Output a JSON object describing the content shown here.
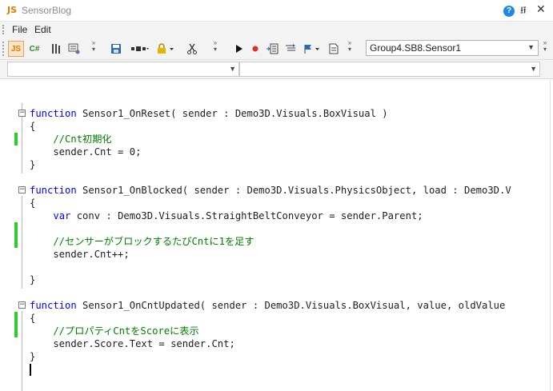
{
  "window": {
    "badge": "JS",
    "title": "SensorBlog",
    "help_glyph": "?",
    "pin_glyph": "⭿",
    "close_glyph": "✕"
  },
  "menu": {
    "items": [
      "File",
      "Edit"
    ]
  },
  "toolbar": {
    "js_label": "JS",
    "cs_label": "C#",
    "sensor_selector": "Group4.SB8.Sensor1"
  },
  "navigation": {
    "left_dropdown": "",
    "right_dropdown": ""
  },
  "code_lines": [
    "",
    "function Sensor1_OnReset( sender : Demo3D.Visuals.BoxVisual )",
    "{",
    "    //Cnt初期化",
    "    sender.Cnt = 0;",
    "}",
    "",
    "function Sensor1_OnBlocked( sender : Demo3D.Visuals.PhysicsObject, load : Demo3D.V",
    "{",
    "    var conv : Demo3D.Visuals.StraightBeltConveyor = sender.Parent;",
    "",
    "    //センサーがブロックするたびCntに1を足す",
    "    sender.Cnt++;",
    "",
    "}",
    "",
    "function Sensor1_OnCntUpdated( sender : Demo3D.Visuals.BoxVisual, value, oldValue",
    "{",
    "    //プロパティCntをScoreに表示",
    "    sender.Score.Text = sender.Cnt;",
    "}",
    ""
  ],
  "colors": {
    "keyword": "#0000ff",
    "comment": "#008000",
    "change_marker": "#2ecc2e",
    "active_button": "#fbe3c6"
  }
}
